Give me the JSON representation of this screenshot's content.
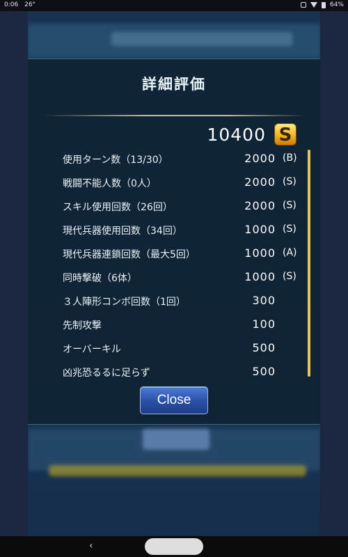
{
  "status_bar": {
    "time": "0:06",
    "temp": "26°",
    "battery": "64%",
    "icons": [
      "alarm-icon",
      "wifi-icon",
      "battery-icon"
    ]
  },
  "dialog": {
    "title": "詳細評価",
    "total_score": "10400",
    "total_rank": "S",
    "items": [
      {
        "label": "使用ターン数（13/30）",
        "value": "2000",
        "grade": "(B)"
      },
      {
        "label": "戦闘不能人数（0人）",
        "value": "2000",
        "grade": "(S)"
      },
      {
        "label": "スキル使用回数（26回）",
        "value": "2000",
        "grade": "(S)"
      },
      {
        "label": "現代兵器使用回数（34回）",
        "value": "1000",
        "grade": "(S)"
      },
      {
        "label": "現代兵器連鎖回数（最大5回）",
        "value": "1000",
        "grade": "(A)"
      },
      {
        "label": "同時撃破（6体）",
        "value": "1000",
        "grade": "(S)"
      },
      {
        "label": "３人陣形コンボ回数（1回）",
        "value": "300",
        "grade": ""
      },
      {
        "label": "先制攻撃",
        "value": "100",
        "grade": ""
      },
      {
        "label": "オーバーキル",
        "value": "500",
        "grade": ""
      },
      {
        "label": "凶兆恐るるに足らず",
        "value": "500",
        "grade": ""
      }
    ],
    "close_label": "Close"
  },
  "nav": {
    "back_glyph": "‹"
  },
  "colors": {
    "accent_gold": "#e6c65a",
    "button_blue": "#2b52a8"
  }
}
